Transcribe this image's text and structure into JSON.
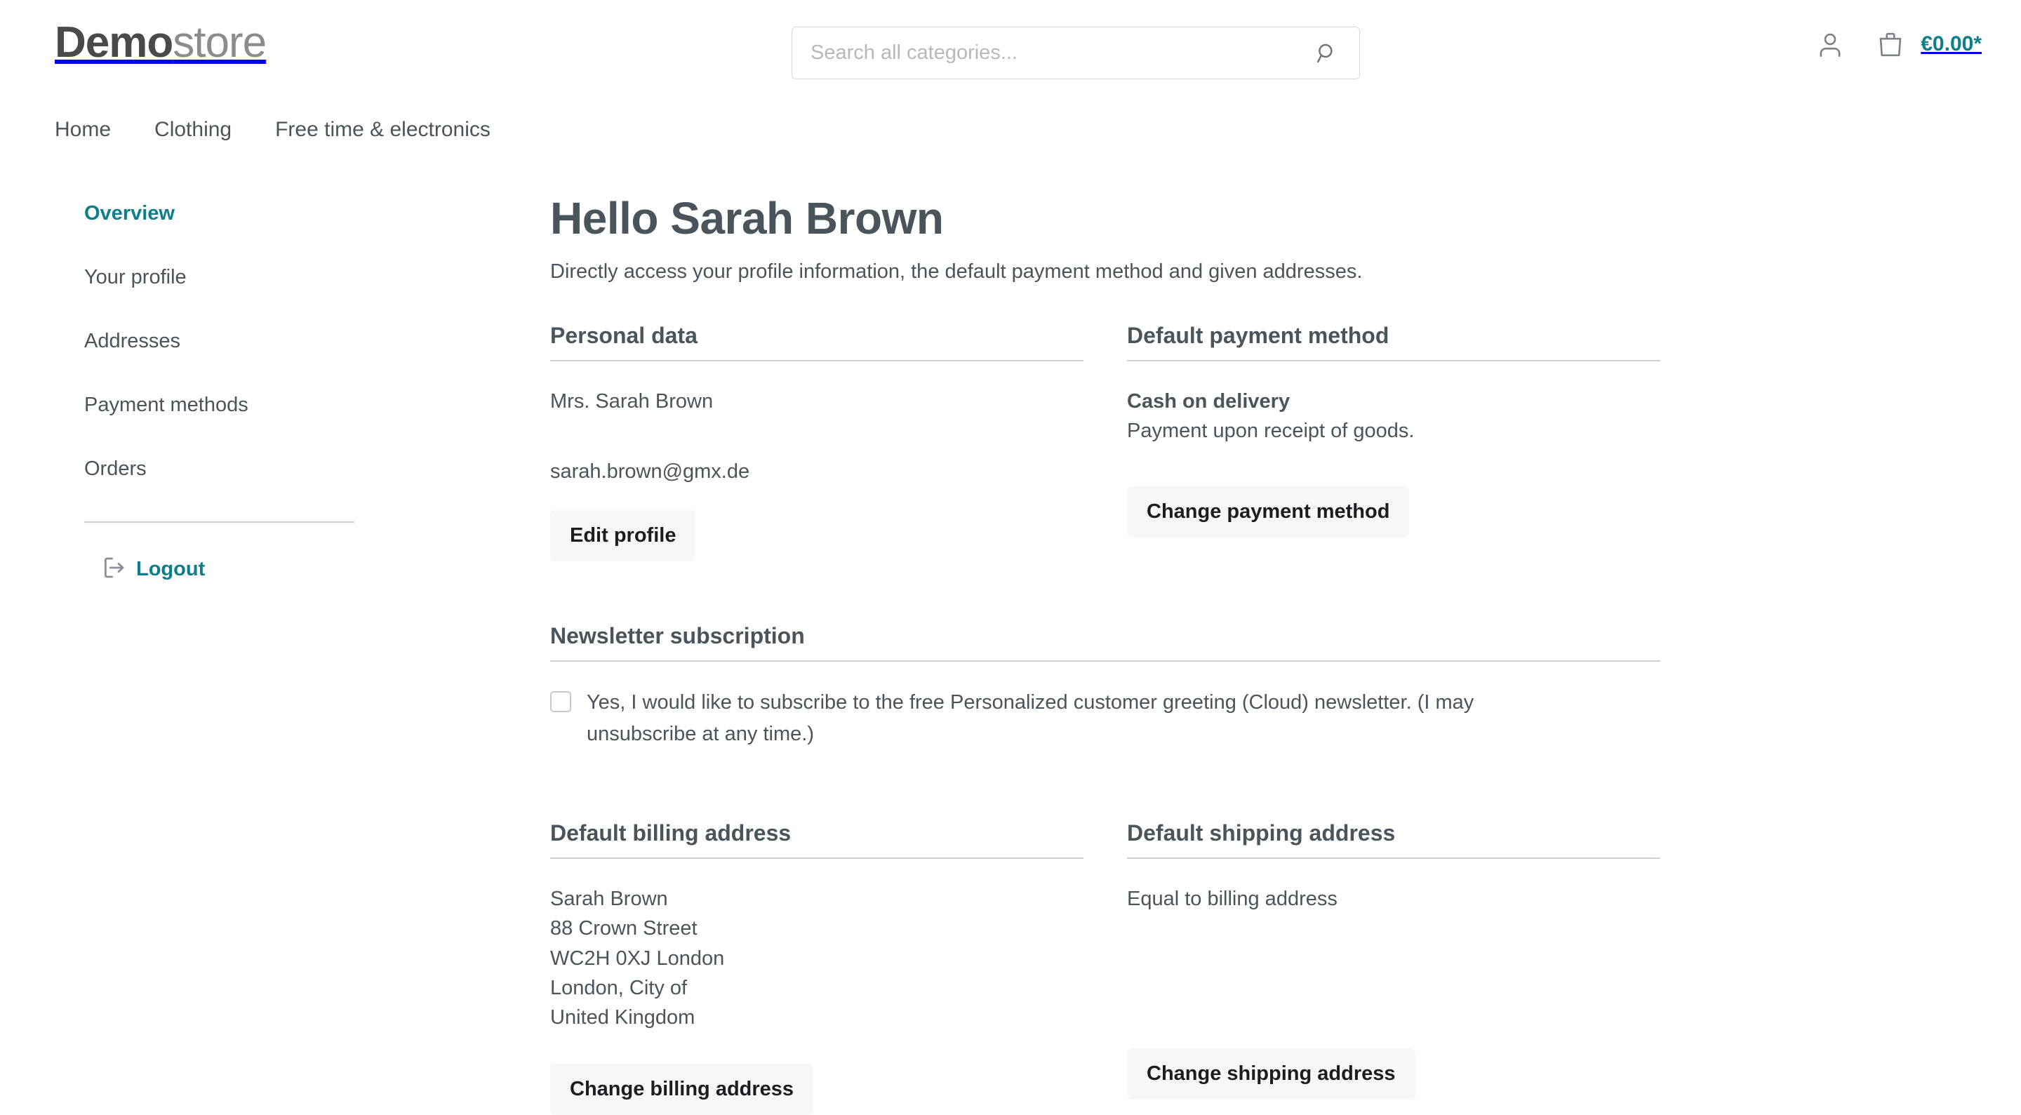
{
  "header": {
    "logo_bold": "Demo",
    "logo_light": "store",
    "search_placeholder": "Search all categories...",
    "search_value": "",
    "search_icon": "search-icon",
    "account_icon": "user-account-icon",
    "cart_icon": "shopping-bag-icon",
    "cart_amount": "€0.00*",
    "accent_color": "#0d7f8c"
  },
  "nav": {
    "items": [
      {
        "label": "Home"
      },
      {
        "label": "Clothing"
      },
      {
        "label": "Free time & electronics"
      }
    ]
  },
  "sidebar": {
    "items": [
      {
        "label": "Overview",
        "active": true
      },
      {
        "label": "Your profile",
        "active": false
      },
      {
        "label": "Addresses",
        "active": false
      },
      {
        "label": "Payment methods",
        "active": false
      },
      {
        "label": "Orders",
        "active": false
      }
    ],
    "logout": {
      "label": "Logout",
      "icon": "logout-arrow-icon"
    }
  },
  "main": {
    "title": "Hello Sarah Brown",
    "subtitle": "Directly access your profile information, the default payment method and given addresses.",
    "personal_data": {
      "heading": "Personal data",
      "name": "Mrs. Sarah Brown",
      "email": "sarah.brown@gmx.de",
      "edit_button": "Edit profile"
    },
    "payment_method": {
      "heading": "Default payment method",
      "method_name": "Cash on delivery",
      "method_description": "Payment upon receipt of goods.",
      "change_button": "Change payment method"
    },
    "newsletter": {
      "heading": "Newsletter subscription",
      "checkbox_checked": false,
      "label": "Yes, I would like to subscribe to the free Personalized customer greeting (Cloud) newsletter. (I may unsubscribe at any time.)"
    },
    "billing_address": {
      "heading": "Default billing address",
      "lines": [
        "Sarah Brown",
        "88 Crown Street",
        "WC2H 0XJ London",
        "London, City of",
        "United Kingdom"
      ],
      "change_button": "Change billing address"
    },
    "shipping_address": {
      "heading": "Default shipping address",
      "lines": [
        "Equal to billing address"
      ],
      "change_button": "Change shipping address"
    }
  }
}
